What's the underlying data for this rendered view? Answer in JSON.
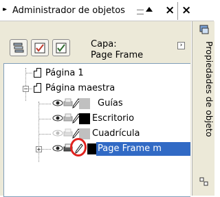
{
  "header": {
    "arrow": "▸▸",
    "title": "Administrador de objetos",
    "close_glyph": "×"
  },
  "toolbar": {
    "buttons": [
      "show-object-properties-icon",
      "edit-across-layers-icon",
      "layer-manager-view-icon"
    ],
    "layer_label": "Capa:",
    "layer_value": "Page Frame",
    "menu_glyph": "›"
  },
  "tree": {
    "items": [
      {
        "label": "Página 1",
        "level": 1
      },
      {
        "label": "Página maestra",
        "level": 1
      },
      {
        "label": "Guías",
        "level": 2,
        "swatch": "#c0c0c0"
      },
      {
        "label": "Escritorio",
        "level": 2,
        "swatch": "#000000"
      },
      {
        "label": "Cuadrícula",
        "level": 2,
        "swatch": "#c0c0c0",
        "dimmed": true
      },
      {
        "label": "Page Frame m",
        "level": 2,
        "swatch": "#000000",
        "selected": true
      }
    ]
  },
  "side_tab": {
    "label": "Propiedades de objeto"
  },
  "colors": {
    "selection": "#316ac5",
    "highlight_circle": "#e1221e",
    "panel": "#ece9d8"
  }
}
